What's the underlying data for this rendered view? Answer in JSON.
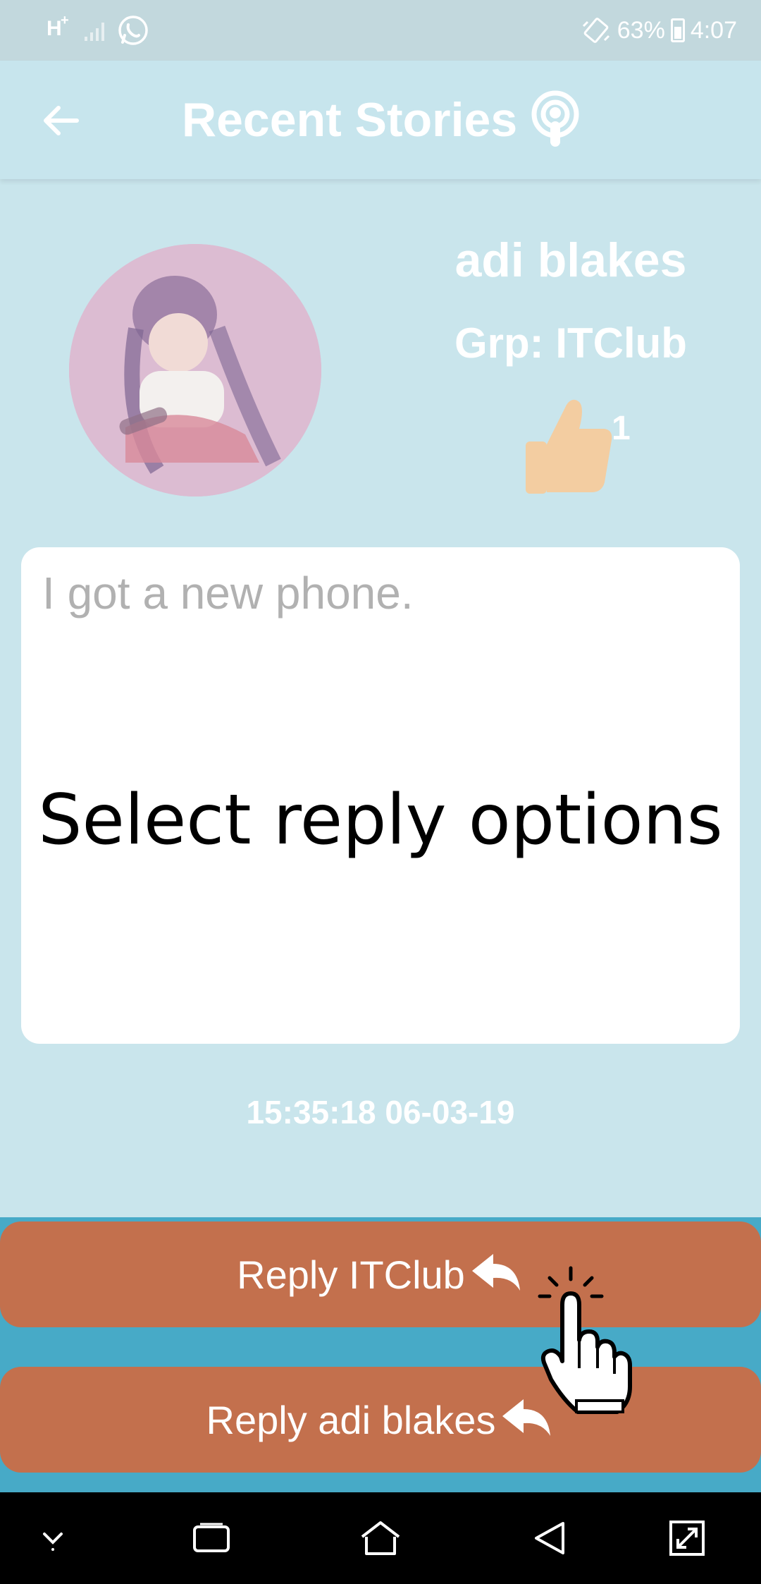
{
  "status_bar": {
    "network_type": "H",
    "network_plus": "+",
    "battery_percent": "63%",
    "time": "4:07",
    "icons": [
      "network-h-icon",
      "signal-icon",
      "whatsapp-icon",
      "vibrate-icon",
      "battery-icon"
    ]
  },
  "app_bar": {
    "title": "Recent Stories",
    "back_icon": "arrow-left-icon",
    "title_icon": "podcast-icon"
  },
  "profile": {
    "name": "adi blakes",
    "group": "Grp: ITClub",
    "like_count": "1",
    "like_icon": "thumbs-up-icon"
  },
  "story": {
    "text": "I got a new phone.",
    "timestamp": "15:35:18 06-03-19"
  },
  "overlay": {
    "instruction": "Select reply options"
  },
  "actions": {
    "reply_group_label": "Reply ITClub",
    "reply_user_label": "Reply adi blakes",
    "reply_icon": "reply-arrow-icon"
  },
  "nav_bar": {
    "icons": [
      "chevron-down-icon",
      "recent-apps-icon",
      "home-icon",
      "back-icon",
      "screen-resize-icon"
    ]
  },
  "colors": {
    "background": "#c9e5ec",
    "button": "#c3704d",
    "button_area": "#47aac7",
    "like_icon": "#f3cda1",
    "avatar_bg": "#d9b9cf"
  }
}
